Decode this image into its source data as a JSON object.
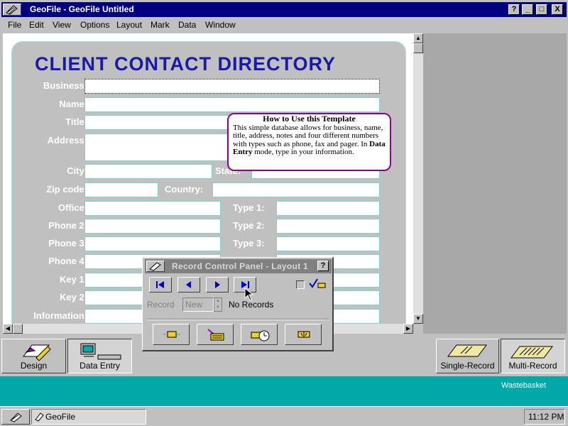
{
  "window": {
    "title": "GeoFile - GeoFile Untitled"
  },
  "titlebar_buttons": [
    "?",
    "_",
    "□",
    "X"
  ],
  "menu": [
    "File",
    "Edit",
    "View",
    "Options",
    "Layout",
    "Mark",
    "Data",
    "Window"
  ],
  "form": {
    "title": "CLIENT CONTACT DIRECTORY",
    "labels": {
      "business": "Business:",
      "name": "Name:",
      "title": "Title:",
      "address": "Address:",
      "city": "City:",
      "state": "State:",
      "zip": "Zip code:",
      "country": "Country:",
      "office": "Office:",
      "phone2": "Phone 2:",
      "phone3": "Phone 3:",
      "phone4": "Phone 4:",
      "key1": "Key 1:",
      "key2": "Key 2:",
      "information": "Information:",
      "type1": "Type 1:",
      "type2": "Type 2:",
      "type3": "Type 3:"
    }
  },
  "tooltip": {
    "title": "How to Use this Template",
    "body_1": "This simple database allows for business, name, title, address, notes and four different numbers with types such as phone, fax and pager.  In ",
    "body_bold": "Data Entry",
    "body_2": " mode, type in your information."
  },
  "record_panel": {
    "title": "Record Control Panel - Layout 1",
    "help": "?",
    "record_label": "Record",
    "record_value": "New",
    "status": "No Records"
  },
  "toolbar": {
    "design": "Design",
    "data_entry": "Data Entry",
    "single_record": "Single-Record",
    "multi_record": "Multi-Record"
  },
  "desktop": {
    "wastebasket": "Wastebasket"
  },
  "taskbar": {
    "app": "GeoFile",
    "time": "11:12 PM"
  },
  "colors": {
    "title_blue": "#1a1aa8",
    "titlebar": "#000080",
    "desktop": "#00a8a8",
    "tooltip_border": "#900090"
  }
}
